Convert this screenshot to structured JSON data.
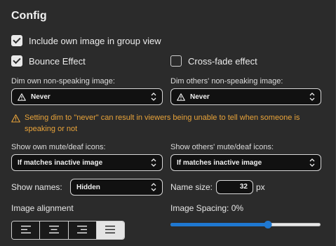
{
  "config": {
    "title": "Config",
    "include_own_image": {
      "label": "Include own image in group view",
      "checked": true
    },
    "bounce_effect": {
      "label": "Bounce Effect",
      "checked": true
    },
    "crossfade_effect": {
      "label": "Cross-fade effect",
      "checked": false
    },
    "dim_own": {
      "label": "Dim own non-speaking image:",
      "value": "Never",
      "icon": "warning-icon"
    },
    "dim_others": {
      "label": "Dim others' non-speaking image:",
      "value": "Never",
      "icon": "warning-icon"
    },
    "warning_text": "Setting dim to \"never\" can result in viewers being unable to tell when someone is speaking or not",
    "warning_color": "#e8a33a",
    "own_mute_icons": {
      "label": "Show own mute/deaf icons:",
      "value": "If matches inactive image"
    },
    "others_mute_icons": {
      "label": "Show others' mute/deaf icons:",
      "value": "If matches inactive image"
    },
    "show_names": {
      "label": "Show names:",
      "value": "Hidden"
    },
    "name_size": {
      "label": "Name size:",
      "value": "32",
      "unit": "px"
    },
    "image_alignment": {
      "label": "Image alignment",
      "options": [
        "align-left-icon",
        "align-center-icon",
        "align-right-icon",
        "align-justify-icon"
      ],
      "selected": "align-justify-icon"
    },
    "image_spacing": {
      "label": "Image Spacing: 0%",
      "slider_fraction": 0.65,
      "accent": "#1f78d1"
    }
  }
}
